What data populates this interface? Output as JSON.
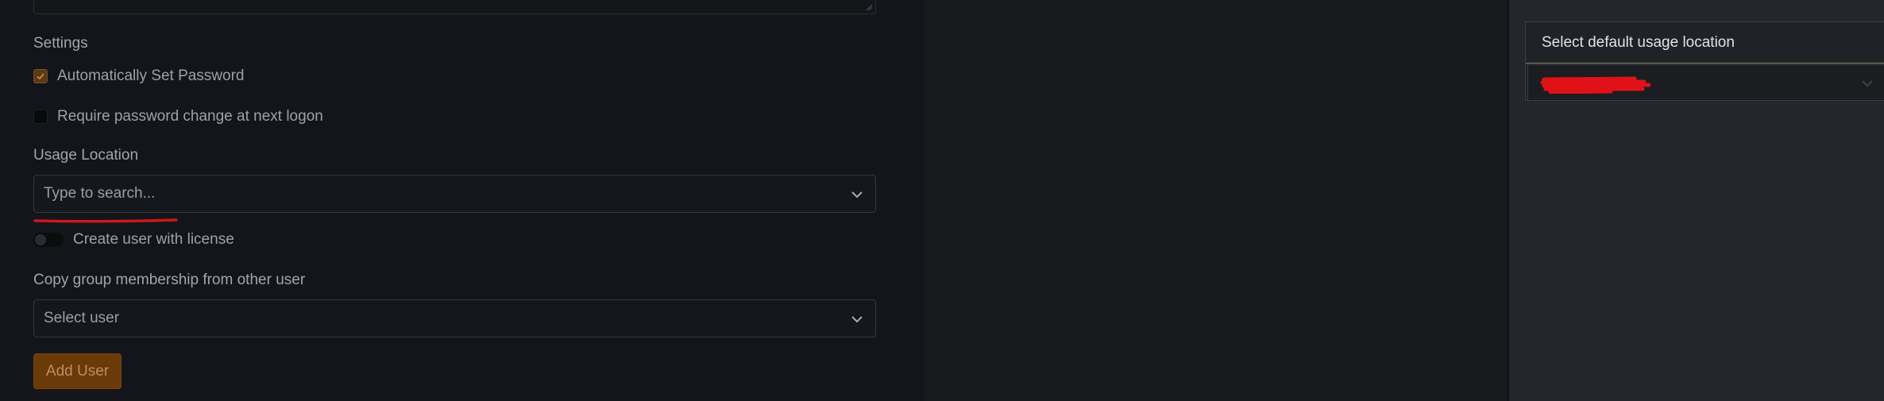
{
  "settings": {
    "heading": "Settings",
    "auto_password_label": "Automatically Set Password",
    "auto_password_checked": true,
    "require_change_label": "Require password change at next logon",
    "require_change_checked": false
  },
  "usage_location": {
    "label": "Usage Location",
    "placeholder": "Type to search..."
  },
  "license": {
    "label": "Create user with license",
    "enabled": false
  },
  "copy_group": {
    "label": "Copy group membership from other user",
    "placeholder": "Select user"
  },
  "actions": {
    "add_user_label": "Add User"
  },
  "default_location": {
    "header": "Select default usage location",
    "selected_value": ""
  },
  "colors": {
    "accent": "#6a3a08",
    "annotation_red": "#d0161b"
  },
  "icons": {
    "select_chevron": "chevron-down-icon",
    "check": "check-icon",
    "resize": "resize-grip-icon"
  }
}
